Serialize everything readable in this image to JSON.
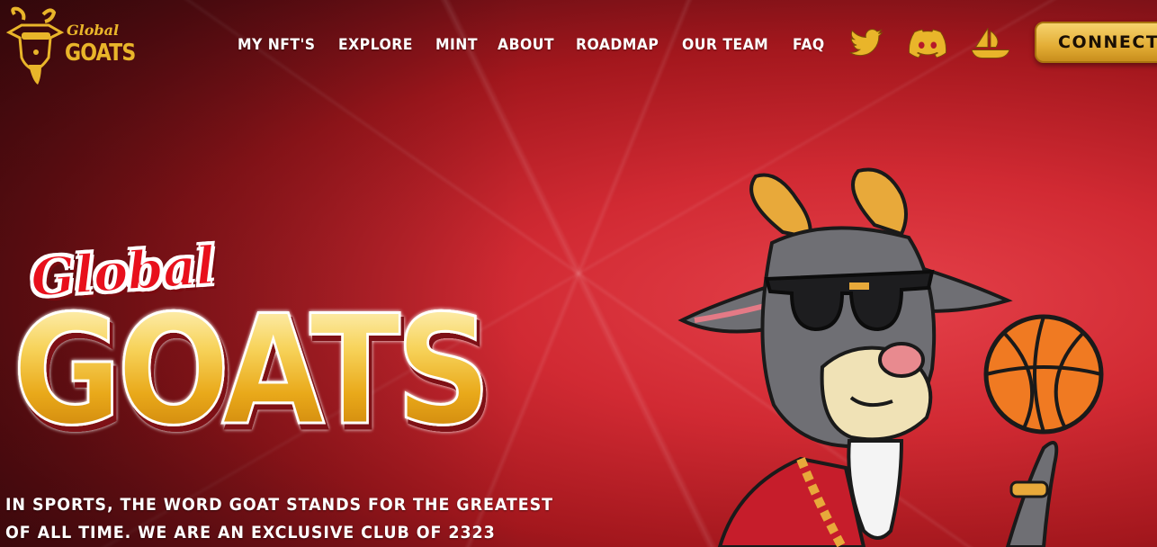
{
  "header": {
    "logo": {
      "line1": "Global",
      "line2": "GOATS"
    },
    "nav": [
      "MY NFT'S",
      "EXPLORE",
      "MINT",
      "ABOUT",
      "ROADMAP",
      "OUR TEAM",
      "FAQ"
    ],
    "social_icons": [
      "twitter-icon",
      "discord-icon",
      "opensea-icon"
    ],
    "connect_label": "CONNECT"
  },
  "hero": {
    "script_title": "Global",
    "big_title": "GOATS",
    "tagline_line1": "IN SPORTS, THE WORD GOAT STANDS FOR THE GREATEST",
    "tagline_line2": "OF ALL TIME. WE ARE AN EXCLUSIVE CLUB OF 2323"
  },
  "colors": {
    "background_red": "#d12a33",
    "gold": "#e9b52a",
    "script_red": "#e8101c",
    "text_white": "#ffffff"
  }
}
